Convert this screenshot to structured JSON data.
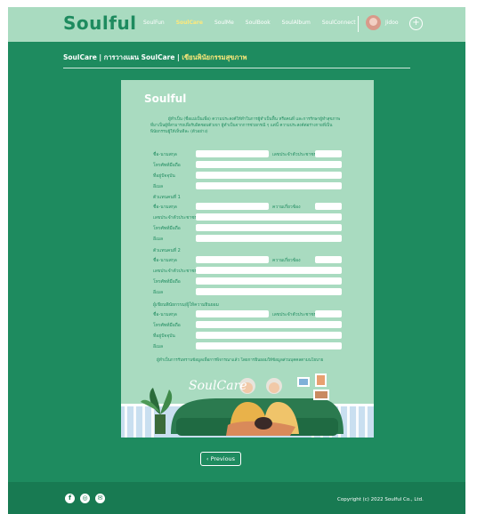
{
  "header": {
    "logo": "Soulful",
    "nav": [
      "SoulFun",
      "SoulCare",
      "SoulMe",
      "SoulBook",
      "SoulAlbum",
      "SoulConnect"
    ],
    "active_index": 1,
    "username": "Jidoo"
  },
  "breadcrumb": {
    "part1": "SoulCare | การวางแผน SoulCare | ",
    "current": "เขียนพินัยกรรมสุขภาพ"
  },
  "card": {
    "logo": "Soulful",
    "intro": "ผู้ทำเป็น (ชื่อแม่เป็นเพื่อ) ความประสงค์ให้ทำในการผู้ทำเป็นฟื้น หรือคนที่ และการรักษาผู้ทำสุขภาพที่มาเป็นผู้ที่สามารถเพื่อรับผิดชอบตัวเขา ผู้ทำเป็นจากการช่วยกรณี ๆ แต่นี้ ความประสงค์ต่อร่างกายที่เป็นพินัยกรรมผู้ให้เห็นทีละ (ตัวอย่าง)",
    "fields_main": {
      "name": "ชื่อ-นามสกุล",
      "id": "เลขประจำตัวประชาชน",
      "phone": "โทรศัพท์มือถือ",
      "address": "ที่อยู่ปัจจุบัน",
      "email": "อีเมล"
    },
    "proxy1_title": "ตัวแทนคนที่ 1",
    "proxy2_title": "ตัวแทนคนที่ 2",
    "relation": "ความเกี่ยวข้อง",
    "doctor_title": "ผู้เขียนพินัยกรรม/ผู้ให้ความยินยอม",
    "note": "ผู้ทำเป็นการรับทราบข้อมูลเพื่อการพิจารณาแล้ว โดยการยินยอมให้ข้อมูลส่วนบุคคลตามนโยบาย",
    "illustration_text": "SoulCare"
  },
  "prev_button": "‹ Previous",
  "footer": {
    "copyright": "Copyright (c) 2022 Soulful Co., Ltd.",
    "social": [
      "facebook-icon",
      "instagram-icon",
      "line-icon"
    ]
  },
  "colors": {
    "green": "#1e8b5f",
    "mint": "#a9dbc0",
    "accent": "#ffe97a"
  }
}
